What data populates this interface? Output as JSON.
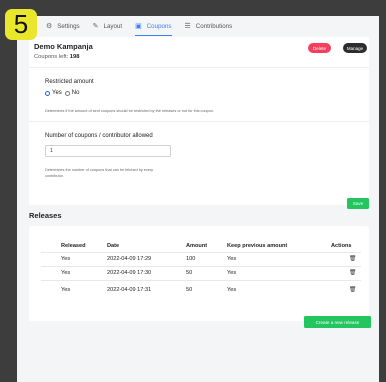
{
  "step_number": "5",
  "tabs": [
    {
      "label": "Settings",
      "icon": "gear-icon",
      "active": false
    },
    {
      "label": "Layout",
      "icon": "pencil-icon",
      "active": false
    },
    {
      "label": "Coupons",
      "icon": "ticket-icon",
      "active": true
    },
    {
      "label": "Contributions",
      "icon": "sliders-icon",
      "active": false
    }
  ],
  "campaign": {
    "title": "Demo Kampanja",
    "coupons_left_label": "Coupons left:",
    "coupons_left_value": "198",
    "delete_label": "Delete",
    "manage_label": "Manage"
  },
  "restricted": {
    "label": "Restricted amount",
    "options": [
      "Yes",
      "No"
    ],
    "selected": "Yes",
    "help": "Determines if the amount of sent coupons should be restricted by the releases or not for this coupon."
  },
  "coupons_per_contributor": {
    "label": "Number of coupons / contributor allowed",
    "value": "1",
    "help": "Determines the number of coupons that can be fetched by every contributor."
  },
  "save_label": "Save",
  "releases": {
    "title": "Releases",
    "columns": [
      "Released",
      "Date",
      "Amount",
      "Keep previous amount",
      "Actions"
    ],
    "rows": [
      {
        "released": "Yes",
        "date": "2022-04-09 17:29",
        "amount": "100",
        "keep": "Yes"
      },
      {
        "released": "Yes",
        "date": "2022-04-09 17:30",
        "amount": "50",
        "keep": "Yes"
      },
      {
        "released": "Yes",
        "date": "2022-04-09 17:31",
        "amount": "50",
        "keep": "Yes"
      }
    ],
    "create_label": "Create a new release"
  },
  "colors": {
    "accent": "#3b82f6",
    "delete": "#f43f5e",
    "success": "#22c55e",
    "badge": "#e9e62c"
  }
}
